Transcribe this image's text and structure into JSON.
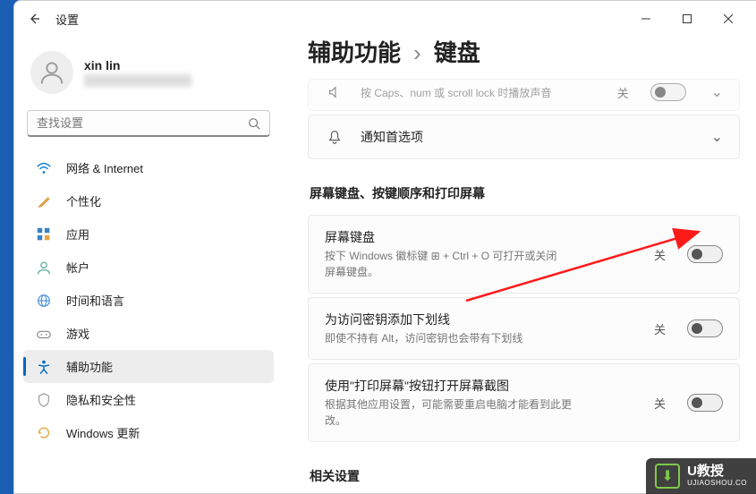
{
  "app_title": "设置",
  "profile": {
    "name": "xin lin"
  },
  "search": {
    "placeholder": "查找设置"
  },
  "nav": {
    "network": "网络 & Internet",
    "personalization": "个性化",
    "apps": "应用",
    "accounts": "帐户",
    "time_language": "时间和语言",
    "gaming": "游戏",
    "accessibility": "辅助功能",
    "privacy": "隐私和安全性",
    "update": "Windows 更新"
  },
  "breadcrumb": {
    "parent": "辅助功能",
    "sep": "›",
    "current": "键盘"
  },
  "caps_card": {
    "desc": "按 Caps、num 或 scroll lock 时播放声音",
    "state": "关"
  },
  "notify_card": {
    "title": "通知首选项"
  },
  "section_osk": "屏幕键盘、按键顺序和打印屏幕",
  "osk": {
    "title": "屏幕键盘",
    "desc": "按下 Windows 徽标键 ⊞ + Ctrl + O 可打开或关闭屏幕键盘。",
    "state": "关"
  },
  "underline": {
    "title": "为访问密钥添加下划线",
    "desc": "即使不持有 Alt，访问密钥也会带有下划线",
    "state": "关"
  },
  "prtsc": {
    "title": "使用\"打印屏幕\"按钮打开屏幕截图",
    "desc": "根据其他应用设置，可能需要重启电脑才能看到此更改。",
    "state": "关"
  },
  "section_related": "相关设置",
  "watermark": {
    "main": "U教授",
    "sub": "UJIAOSHOU.CO"
  }
}
